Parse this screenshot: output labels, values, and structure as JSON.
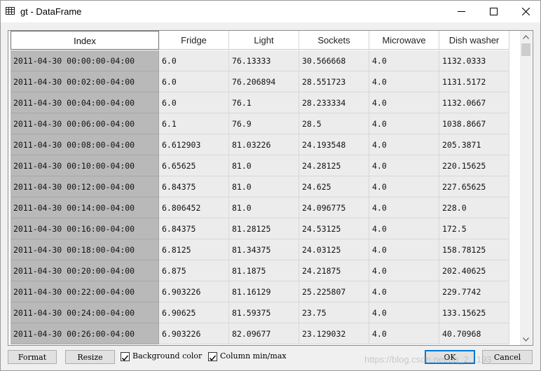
{
  "window": {
    "title": "gt - DataFrame",
    "icons": {
      "app": "table-icon",
      "minimize": "minimize-icon",
      "maximize": "maximize-icon",
      "close": "close-icon"
    }
  },
  "table": {
    "columns": [
      "Index",
      "Fridge",
      "Light",
      "Sockets",
      "Microwave",
      "Dish washer"
    ],
    "rows": [
      [
        "2011-04-30 00:00:00-04:00",
        "6.0",
        "76.13333",
        "30.566668",
        "4.0",
        "1132.0333"
      ],
      [
        "2011-04-30 00:02:00-04:00",
        "6.0",
        "76.206894",
        "28.551723",
        "4.0",
        "1131.5172"
      ],
      [
        "2011-04-30 00:04:00-04:00",
        "6.0",
        "76.1",
        "28.233334",
        "4.0",
        "1132.0667"
      ],
      [
        "2011-04-30 00:06:00-04:00",
        "6.1",
        "76.9",
        "28.5",
        "4.0",
        "1038.8667"
      ],
      [
        "2011-04-30 00:08:00-04:00",
        "6.612903",
        "81.03226",
        "24.193548",
        "4.0",
        "205.3871"
      ],
      [
        "2011-04-30 00:10:00-04:00",
        "6.65625",
        "81.0",
        "24.28125",
        "4.0",
        "220.15625"
      ],
      [
        "2011-04-30 00:12:00-04:00",
        "6.84375",
        "81.0",
        "24.625",
        "4.0",
        "227.65625"
      ],
      [
        "2011-04-30 00:14:00-04:00",
        "6.806452",
        "81.0",
        "24.096775",
        "4.0",
        "228.0"
      ],
      [
        "2011-04-30 00:16:00-04:00",
        "6.84375",
        "81.28125",
        "24.53125",
        "4.0",
        "172.5"
      ],
      [
        "2011-04-30 00:18:00-04:00",
        "6.8125",
        "81.34375",
        "24.03125",
        "4.0",
        "158.78125"
      ],
      [
        "2011-04-30 00:20:00-04:00",
        "6.875",
        "81.1875",
        "24.21875",
        "4.0",
        "202.40625"
      ],
      [
        "2011-04-30 00:22:00-04:00",
        "6.903226",
        "81.16129",
        "25.225807",
        "4.0",
        "229.7742"
      ],
      [
        "2011-04-30 00:24:00-04:00",
        "6.90625",
        "81.59375",
        "23.75",
        "4.0",
        "133.15625"
      ],
      [
        "2011-04-30 00:26:00-04:00",
        "6.903226",
        "82.09677",
        "23.129032",
        "4.0",
        "40.70968"
      ]
    ]
  },
  "footer": {
    "format_label": "Format",
    "resize_label": "Resize",
    "background_color_label": "Background color",
    "background_color_checked": true,
    "column_minmax_label": "Column min/max",
    "column_minmax_checked": true,
    "ok_label": "OK",
    "cancel_label": "Cancel"
  },
  "watermark": "https://blog.csdn.net/qq_2...193"
}
